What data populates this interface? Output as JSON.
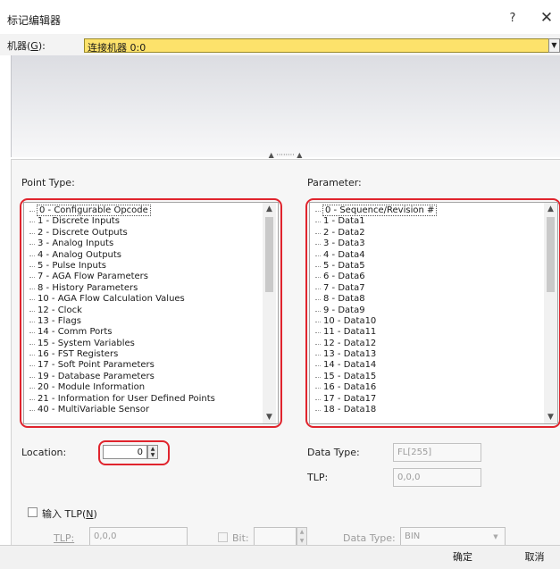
{
  "window": {
    "title": "标记编辑器",
    "help_glyph": "?",
    "close_glyph": "✕"
  },
  "device": {
    "label_prefix": "机器(",
    "label_key": "G",
    "label_suffix": "):",
    "value": "连接机器 0:0"
  },
  "splitter": {
    "glyph": "▲ ········ ▲"
  },
  "point_type": {
    "label": "Point Type:",
    "items": [
      "0 - Configurable Opcode",
      "1 - Discrete Inputs",
      "2 - Discrete Outputs",
      "3 - Analog Inputs",
      "4 - Analog Outputs",
      "5 - Pulse Inputs",
      "7 - AGA Flow Parameters",
      "8 - History Parameters",
      "10 - AGA Flow Calculation Values",
      "12 - Clock",
      "13 - Flags",
      "14 - Comm Ports",
      "15 - System Variables",
      "16 - FST Registers",
      "17 - Soft Point Parameters",
      "19 - Database Parameters",
      "20 - Module Information",
      "21 - Information for User Defined Points",
      "40 - MultiVariable Sensor"
    ],
    "selected_index": 0
  },
  "parameter": {
    "label": "Parameter:",
    "items": [
      "0 - Sequence/Revision #",
      "1 - Data1",
      "2 - Data2",
      "3 - Data3",
      "4 - Data4",
      "5 - Data5",
      "6 - Data6",
      "7 - Data7",
      "8 - Data8",
      "9 - Data9",
      "10 - Data10",
      "11 - Data11",
      "12 - Data12",
      "13 - Data13",
      "14 - Data14",
      "15 - Data15",
      "16 - Data16",
      "17 - Data17",
      "18 - Data18"
    ],
    "selected_index": 0
  },
  "location": {
    "label": "Location:",
    "value": "0"
  },
  "data_type": {
    "label": "Data Type:",
    "value": "FL[255]"
  },
  "tlp": {
    "label": "TLP:",
    "value": "0,0,0"
  },
  "input_tlp": {
    "label": "输入 TLP(",
    "key": "N",
    "suffix": ")",
    "checked": false
  },
  "bottom_tlp": {
    "label": "TLP:",
    "value": "0,0,0"
  },
  "bit": {
    "label": "Bit:",
    "value": ""
  },
  "bottom_data_type": {
    "label": "Data Type:",
    "value": "BIN"
  },
  "buttons": {
    "ok": "确定",
    "cancel": "取消"
  },
  "colors": {
    "device_combo": "#fde26b",
    "highlight_outline": "#e0242d"
  }
}
